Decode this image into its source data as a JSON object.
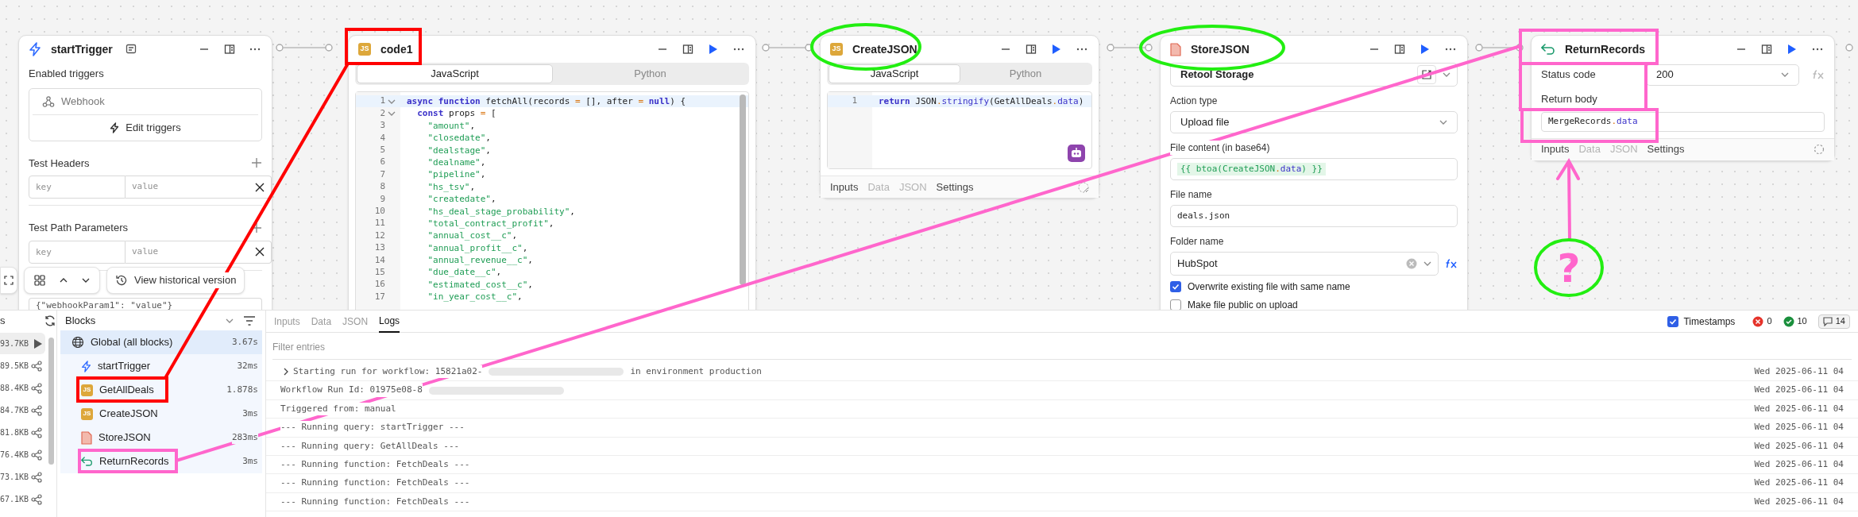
{
  "canvas": {
    "nodes": [
      {
        "kind": "trigger",
        "title": "startTrigger",
        "enabled_triggers": {
          "label": "Enabled triggers",
          "items": [
            "Webhook"
          ],
          "edit_button": "Edit triggers"
        },
        "param_groups": [
          {
            "label": "Test Headers",
            "key_placeholder": "key",
            "value_placeholder": "value"
          },
          {
            "label": "Test Path Parameters",
            "key_placeholder": "key",
            "value_placeholder": "value"
          }
        ],
        "json_value": "{\"webhookParam1\": \"value\"}"
      },
      {
        "kind": "code",
        "title": "code1",
        "badge": "JS",
        "language_tabs": [
          {
            "label": "JavaScript",
            "selected": true
          },
          {
            "label": "Python",
            "selected": false
          }
        ],
        "lines": [
          {
            "number": "1",
            "text": "async function fetchAll(records = [], after = null) {",
            "fold": true,
            "highlighted": true
          },
          {
            "number": "2",
            "text": "  const props = [",
            "fold": true,
            "highlighted": false
          },
          {
            "number": "3",
            "text": "    \"amount\",",
            "fold": false,
            "highlighted": false
          },
          {
            "number": "4",
            "text": "    \"closedate\",",
            "fold": false,
            "highlighted": false
          },
          {
            "number": "5",
            "text": "    \"dealstage\",",
            "fold": false,
            "highlighted": false
          },
          {
            "number": "6",
            "text": "    \"dealname\",",
            "fold": false,
            "highlighted": false
          },
          {
            "number": "7",
            "text": "    \"pipeline\",",
            "fold": false,
            "highlighted": false
          },
          {
            "number": "8",
            "text": "    \"hs_tsv\",",
            "fold": false,
            "highlighted": false
          },
          {
            "number": "9",
            "text": "    \"createdate\",",
            "fold": false,
            "highlighted": false
          },
          {
            "number": "10",
            "text": "    \"hs_deal_stage_probability\",",
            "fold": false,
            "highlighted": false
          },
          {
            "number": "11",
            "text": "    \"total_contract_profit\",",
            "fold": false,
            "highlighted": false
          },
          {
            "number": "12",
            "text": "    \"annual_cost__c\",",
            "fold": false,
            "highlighted": false
          },
          {
            "number": "13",
            "text": "    \"annual_profit__c\",",
            "fold": false,
            "highlighted": false
          },
          {
            "number": "14",
            "text": "    \"annual_revenue__c\",",
            "fold": false,
            "highlighted": false
          },
          {
            "number": "15",
            "text": "    \"due_date__c\",",
            "fold": false,
            "highlighted": false
          },
          {
            "number": "16",
            "text": "    \"estimated_cost__c\",",
            "fold": false,
            "highlighted": false
          },
          {
            "number": "17",
            "text": "    \"in_year_cost__c\",",
            "fold": false,
            "highlighted": false
          }
        ]
      },
      {
        "kind": "code",
        "title": "CreateJSON",
        "badge": "JS",
        "language_tabs": [
          {
            "label": "JavaScript",
            "selected": true
          },
          {
            "label": "Python",
            "selected": false
          }
        ],
        "lines": [
          {
            "number": "1",
            "text": "return JSON.stringify(GetAllDeals.data)",
            "fold": false,
            "highlighted": true
          }
        ],
        "assistant_button": true,
        "footer_tabs": [
          {
            "label": "Inputs",
            "disabled": false
          },
          {
            "label": "Data",
            "disabled": true
          },
          {
            "label": "JSON",
            "disabled": true
          },
          {
            "label": "Settings",
            "disabled": false
          }
        ]
      },
      {
        "kind": "storage",
        "title": "StoreJSON",
        "resource": "Retool Storage",
        "fields": [
          {
            "kind": "select",
            "label": "Action type",
            "value": "Upload file"
          },
          {
            "kind": "code",
            "label": "File content (in base64)",
            "value": "{{ btoa(CreateJSON.data) }}"
          },
          {
            "kind": "text",
            "label": "File name",
            "value": "deals.json"
          },
          {
            "kind": "combo",
            "label": "Folder name",
            "value": "HubSpot"
          }
        ],
        "checkboxes": [
          {
            "label": "Overwrite existing file with same name",
            "checked": true
          },
          {
            "label": "Make file public on upload",
            "checked": false
          }
        ]
      },
      {
        "kind": "return",
        "title": "ReturnRecords",
        "status": {
          "label": "Status code",
          "value": "200"
        },
        "body": {
          "label": "Return body",
          "value": "MergeRecords.data"
        },
        "footer_tabs": [
          {
            "label": "Inputs",
            "disabled": false
          },
          {
            "label": "Data",
            "disabled": true
          },
          {
            "label": "JSON",
            "disabled": true
          },
          {
            "label": "Settings",
            "disabled": false
          }
        ]
      }
    ]
  },
  "toolbar": {
    "history_button": "View historical version"
  },
  "runs": {
    "header": "s",
    "items": [
      {
        "size": "93.7KB",
        "selected": true
      },
      {
        "size": "89.5KB",
        "selected": false
      },
      {
        "size": "88.4KB",
        "selected": false
      },
      {
        "size": "84.7KB",
        "selected": false
      },
      {
        "size": "81.8KB",
        "selected": false
      },
      {
        "size": "76.4KB",
        "selected": false
      },
      {
        "size": "73.1KB",
        "selected": false
      },
      {
        "size": "67.1KB",
        "selected": false
      }
    ]
  },
  "blocks": {
    "title": "Blocks",
    "items": [
      {
        "kind": "global",
        "name": "Global (all blocks)",
        "time": "3.67s",
        "selected": true,
        "children": [
          {
            "kind": "trigger",
            "name": "startTrigger",
            "time": "32ms",
            "selected": false
          },
          {
            "kind": "js",
            "badge": "JS",
            "name": "GetAllDeals",
            "time": "1.878s",
            "selected": false
          },
          {
            "kind": "js",
            "badge": "JS",
            "name": "CreateJSON",
            "time": "3ms",
            "selected": false
          },
          {
            "kind": "file",
            "name": "StoreJSON",
            "time": "283ms",
            "selected": false
          },
          {
            "kind": "return",
            "name": "ReturnRecords",
            "time": "3ms",
            "selected": false
          }
        ]
      }
    ]
  },
  "logs": {
    "tabs": [
      {
        "label": "Inputs",
        "selected": false
      },
      {
        "label": "Data",
        "selected": false
      },
      {
        "label": "JSON",
        "selected": false
      },
      {
        "label": "Logs",
        "selected": true
      }
    ],
    "timestamps": {
      "label": "Timestamps",
      "checked": true
    },
    "counts": [
      {
        "kind": "error",
        "value": "0"
      },
      {
        "kind": "success",
        "value": "10"
      },
      {
        "kind": "message",
        "value": "14"
      }
    ],
    "filter_placeholder": "Filter entries",
    "entries": [
      {
        "text": "Starting run for workflow: 15821a02-",
        "redacted": true,
        "text_after": "in environment production",
        "expandable": true,
        "time": "Wed 2025-06-11 04"
      },
      {
        "text": "Workflow Run Id: 01975e08-8",
        "redacted": true,
        "expandable": false,
        "time": "Wed 2025-06-11 04"
      },
      {
        "text": "Triggered from: manual",
        "redacted": false,
        "expandable": false,
        "time": "Wed 2025-06-11 04"
      },
      {
        "text": "--- Running query: startTrigger ---",
        "redacted": false,
        "expandable": false,
        "time": "Wed 2025-06-11 04"
      },
      {
        "text": "--- Running query: GetAllDeals ---",
        "redacted": false,
        "expandable": false,
        "time": "Wed 2025-06-11 04"
      },
      {
        "text": "--- Running function: FetchDeals ---",
        "redacted": false,
        "expandable": false,
        "time": "Wed 2025-06-11 04"
      },
      {
        "text": "--- Running function: FetchDeals ---",
        "redacted": false,
        "expandable": false,
        "time": "Wed 2025-06-11 04"
      },
      {
        "text": "--- Running function: FetchDeals ---",
        "redacted": false,
        "expandable": false,
        "time": "Wed 2025-06-11 04"
      }
    ]
  },
  "annotations": [
    {
      "kind": "box",
      "color": "#ff0000"
    },
    {
      "kind": "line",
      "color": "#ff0000"
    },
    {
      "kind": "box",
      "color": "#ff0000"
    },
    {
      "kind": "ellipse",
      "color": "#22ee11"
    },
    {
      "kind": "ellipse",
      "color": "#22ee11"
    },
    {
      "kind": "box",
      "color": "#ff66cc"
    },
    {
      "kind": "box",
      "color": "#ff66cc"
    },
    {
      "kind": "box",
      "color": "#ff66cc"
    },
    {
      "kind": "line",
      "color": "#ff66cc"
    },
    {
      "kind": "box",
      "color": "#ff66cc"
    },
    {
      "kind": "arrow",
      "color": "#ff66cc"
    },
    {
      "kind": "ellipse",
      "color": "#22ee11"
    },
    {
      "kind": "question",
      "color": "#ff66cc",
      "text": "?"
    }
  ]
}
